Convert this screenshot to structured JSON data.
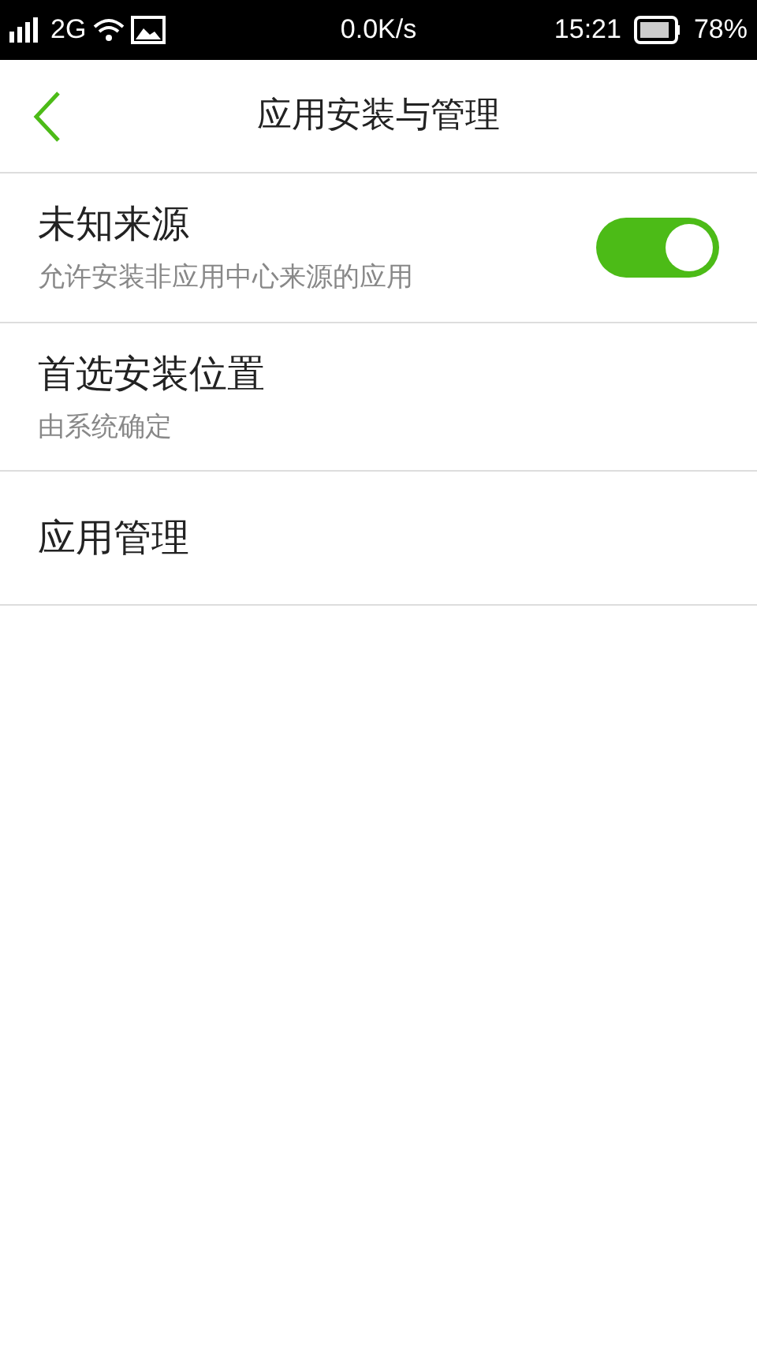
{
  "status_bar": {
    "network": "2G",
    "speed": "0.0K/s",
    "time": "15:21",
    "battery": "78%"
  },
  "header": {
    "title": "应用安装与管理"
  },
  "items": [
    {
      "kind": "toggle",
      "title": "未知来源",
      "subtitle": "允许安装非应用中心来源的应用",
      "on": true
    },
    {
      "kind": "value",
      "title": "首选安装位置",
      "subtitle": "由系统确定"
    },
    {
      "kind": "link",
      "title": "应用管理"
    }
  ]
}
